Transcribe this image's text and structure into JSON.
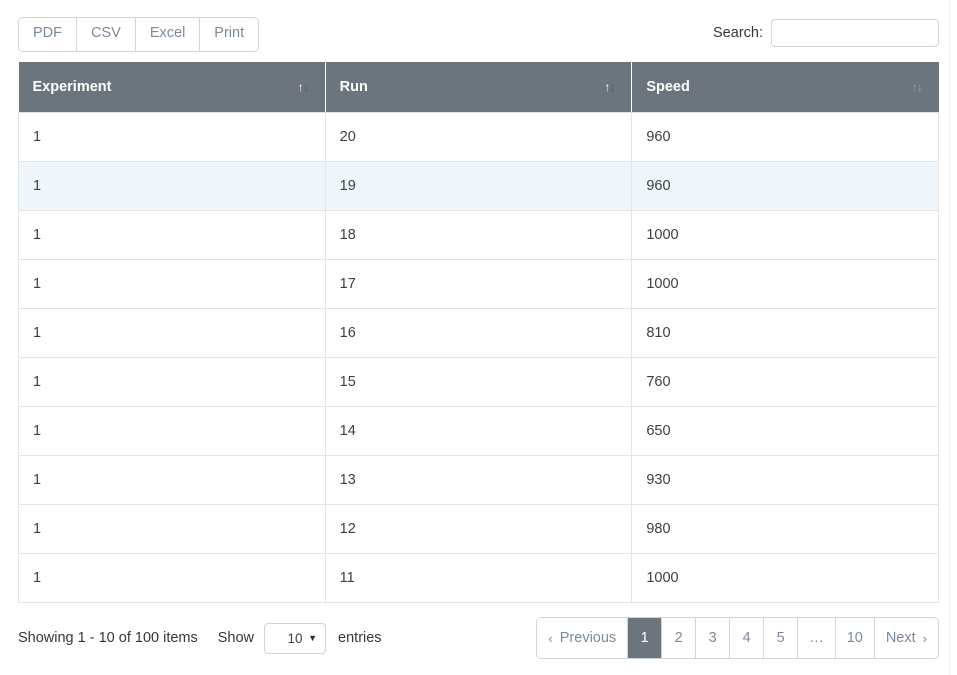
{
  "toolbar": {
    "export_buttons": [
      {
        "label": "PDF",
        "name": "pdf"
      },
      {
        "label": "CSV",
        "name": "csv"
      },
      {
        "label": "Excel",
        "name": "excel"
      },
      {
        "label": "Print",
        "name": "print"
      }
    ]
  },
  "search": {
    "label": "Search:",
    "value": "",
    "placeholder": ""
  },
  "table": {
    "columns": [
      {
        "label": "Experiment",
        "sort": "sortable-active"
      },
      {
        "label": "Run",
        "sort": "sortable-active"
      },
      {
        "label": "Speed",
        "sort": "sortable-muted"
      }
    ],
    "sort_icon": {
      "up": "↑",
      "down": "↓"
    },
    "rows": [
      {
        "experiment": "1",
        "run": "20",
        "speed": "960",
        "highlighted": false
      },
      {
        "experiment": "1",
        "run": "19",
        "speed": "960",
        "highlighted": true
      },
      {
        "experiment": "1",
        "run": "18",
        "speed": "1000",
        "highlighted": false
      },
      {
        "experiment": "1",
        "run": "17",
        "speed": "1000",
        "highlighted": false
      },
      {
        "experiment": "1",
        "run": "16",
        "speed": "810",
        "highlighted": false
      },
      {
        "experiment": "1",
        "run": "15",
        "speed": "760",
        "highlighted": false
      },
      {
        "experiment": "1",
        "run": "14",
        "speed": "650",
        "highlighted": false
      },
      {
        "experiment": "1",
        "run": "13",
        "speed": "930",
        "highlighted": false
      },
      {
        "experiment": "1",
        "run": "12",
        "speed": "980",
        "highlighted": false
      },
      {
        "experiment": "1",
        "run": "11",
        "speed": "1000",
        "highlighted": false
      }
    ]
  },
  "footer": {
    "showing_text": "Showing 1 - 10 of 100 items",
    "show_word": "Show",
    "entries_value": "10",
    "entries_caret": "▼",
    "entries_word": "entries",
    "pagination": [
      {
        "label": "Previous",
        "type": "prev",
        "chevron": "‹",
        "active": false
      },
      {
        "label": "1",
        "type": "page",
        "active": true
      },
      {
        "label": "2",
        "type": "page",
        "active": false
      },
      {
        "label": "3",
        "type": "page",
        "active": false
      },
      {
        "label": "4",
        "type": "page",
        "active": false
      },
      {
        "label": "5",
        "type": "page",
        "active": false
      },
      {
        "label": "…",
        "type": "ellipsis",
        "active": false
      },
      {
        "label": "10",
        "type": "page",
        "active": false
      },
      {
        "label": "Next",
        "type": "next",
        "chevron": "›",
        "active": false
      }
    ]
  },
  "colors": {
    "header_bg": "#6c757d",
    "row_highlight": "#eff7fd",
    "border": "#ced4da",
    "muted_text": "#7b8a9a",
    "active_page_bg": "#6c757d"
  }
}
